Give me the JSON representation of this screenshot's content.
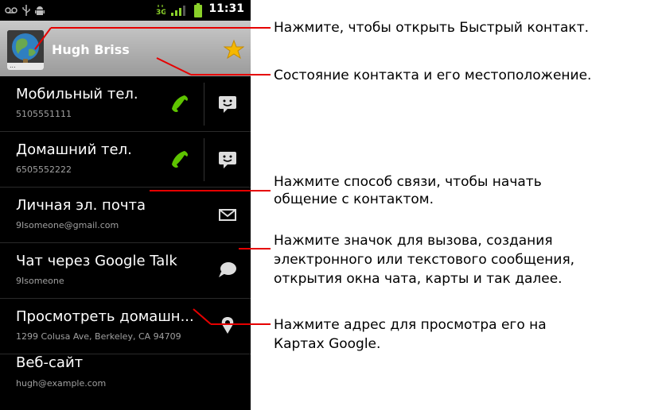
{
  "status_bar": {
    "time": "11:31",
    "icons": [
      "voicemail-icon",
      "usb-icon",
      "android-debug-icon",
      "network-3g-icon",
      "signal-icon",
      "battery-icon"
    ]
  },
  "header": {
    "contact_name": "Hugh Briss",
    "avatar_more": "...",
    "starred": true
  },
  "entries": [
    {
      "label": "Мобильный тел.",
      "value": "5105551111",
      "actions": [
        "call-icon",
        "sms-icon"
      ]
    },
    {
      "label": "Домашний тел.",
      "value": "6505552222",
      "actions": [
        "call-icon",
        "sms-icon"
      ]
    },
    {
      "label": "Личная эл. почта",
      "value": "9Isomeone@gmail.com",
      "actions": [
        "email-icon"
      ]
    },
    {
      "label": "Чат через Google Talk",
      "value": "9Isomeone",
      "actions": [
        "chat-icon"
      ]
    },
    {
      "label": "Просмотреть домашн...",
      "value": "1299 Colusa Ave, Berkeley, CA 94709",
      "actions": [
        "map-pin-icon"
      ]
    },
    {
      "label": "Веб-сайт",
      "value": "hugh@example.com",
      "actions": []
    }
  ],
  "annotations": {
    "quick_contact": "Нажмите, чтобы открыть Быстрый контакт.",
    "status": "Состояние контакта и его местоположение.",
    "method_line1": "Нажмите способ связи, чтобы начать",
    "method_line2": "общение с контактом.",
    "icon_line1": "Нажмите значок для вызова, создания",
    "icon_line2": "электронного или текстового сообщения,",
    "icon_line3": "открытия окна чата, карты и так далее.",
    "address_line1": "Нажмите адрес для просмотра его на",
    "address_line2": "Картах Google."
  },
  "colors": {
    "annotation_line": "#e60000",
    "call_green": "#5ec400",
    "star_gold": "#f5b800"
  }
}
